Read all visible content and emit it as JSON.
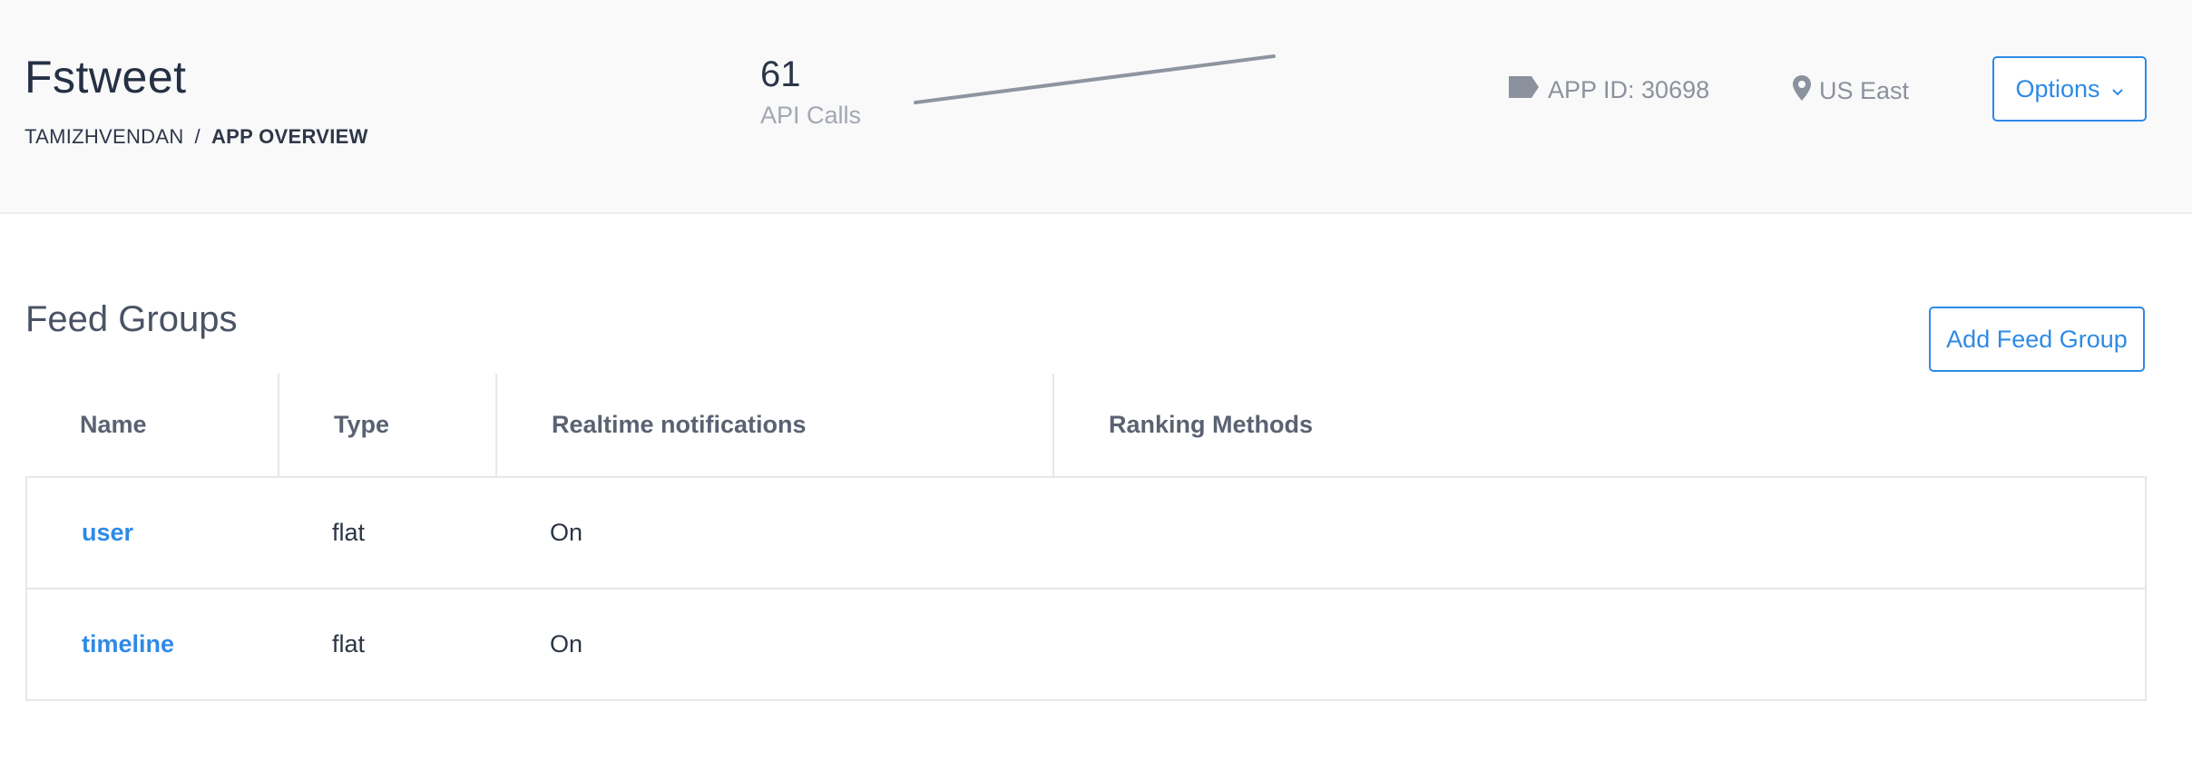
{
  "app": {
    "title": "Fstweet",
    "breadcrumb": {
      "owner": "TAMIZHVENDAN",
      "separator": "/",
      "current": "APP OVERVIEW"
    }
  },
  "stats": {
    "api_calls_value": "61",
    "api_calls_label": "API Calls"
  },
  "meta": {
    "app_id": "APP ID: 30698",
    "region": "US East",
    "app_id_icon": "tag-icon",
    "region_icon": "map-pin-icon"
  },
  "header": {
    "options_label": "Options"
  },
  "feed_groups": {
    "title": "Feed Groups",
    "add_button_label": "Add Feed Group",
    "columns": [
      "Name",
      "Type",
      "Realtime notifications",
      "Ranking Methods"
    ],
    "rows": [
      {
        "name": "user",
        "type": "flat",
        "realtime": "On",
        "ranking": ""
      },
      {
        "name": "timeline",
        "type": "flat",
        "realtime": "On",
        "ranking": ""
      }
    ]
  },
  "colors": {
    "accent": "#2e8ae6",
    "header_bg": "#f9f9fa",
    "muted_text": "#8b929d",
    "border": "#e5e7eb"
  }
}
